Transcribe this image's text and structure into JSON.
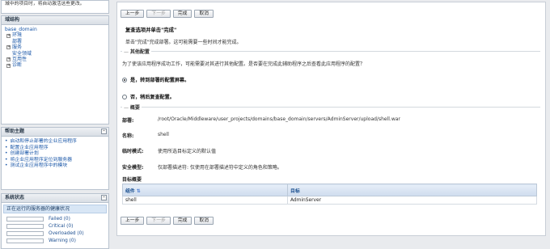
{
  "left": {
    "top_note": "城中的项目时，将自动激活这些更改。",
    "structure": {
      "title": "域结构",
      "root": "base_domain",
      "items": [
        "环境",
        "部署",
        "服务",
        "安全领域",
        "互用性",
        "诊断"
      ]
    },
    "help": {
      "title": "帮助主题",
      "links": [
        "启动和停止部署的企业应用程序",
        "配置企业应用程序",
        "创建部署计划",
        "将企业应用程序定位到服务器",
        "测试企业应用程序中的模块"
      ]
    },
    "system": {
      "title": "系统状态",
      "subtitle": "正在运行的服务器的健康状况",
      "rows": [
        {
          "label": "Failed (0)"
        },
        {
          "label": "Critical (0)"
        },
        {
          "label": "Overloaded (0)"
        },
        {
          "label": "Warning (0)"
        }
      ]
    }
  },
  "toolbar": {
    "back": "上一步",
    "next": "下一步",
    "finish": "完成",
    "cancel": "取消"
  },
  "main": {
    "heading": "复查选项并单击\"完成\"",
    "subheading": "单击\"完成\"完成部署。这可能需要一些时间才能完成。",
    "other_section": "其他配置",
    "question": "为了使该应用程序成功工作，可能需要对其进行其他配置。是否要在完成此辅助程序之后查看此应用程序的配置？",
    "radio_yes": "是，转到部署的配置屏幕。",
    "radio_no": "否，稍后复查配置。",
    "summary_section": "概要",
    "summary": [
      {
        "k": "部署:",
        "v": "/root/Oracle/Middleware/user_projects/domains/base_domain/servers/AdminServer/upload/shell.war"
      },
      {
        "k": "名称:",
        "v": "shell"
      },
      {
        "k": "临时模式:",
        "v": "使用所选目标定义的默认值"
      },
      {
        "k": "安全模型:",
        "v": "仅部署描述符: 仅使用在部署描述符中定义的角色和策略。"
      }
    ],
    "target_title": "目标概要",
    "table": {
      "headers": [
        "组件",
        "目标"
      ],
      "rows": [
        [
          "shell",
          "AdminServer"
        ]
      ]
    }
  }
}
